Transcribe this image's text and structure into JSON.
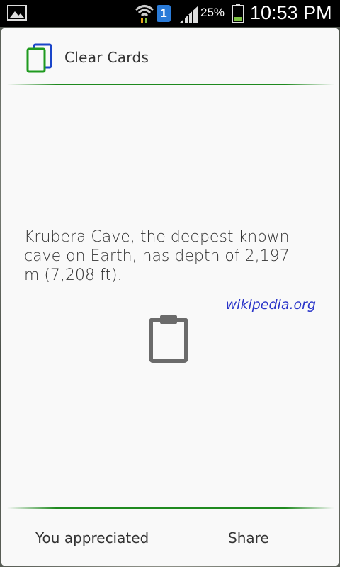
{
  "status_bar": {
    "battery_percent": "25%",
    "time": "10:53 PM",
    "sim_slot": "1",
    "icons": [
      "gallery-icon",
      "wifi-icon",
      "sim-icon",
      "signal-icon",
      "battery-icon"
    ]
  },
  "header": {
    "app_title": "Clear Cards",
    "app_icon": "cards-icon"
  },
  "card": {
    "fact_text": "Krubera Cave, the deepest known cave on Earth, has depth of 2,197 m (7,208 ft).",
    "source": "wikipedia.org",
    "center_icon": "clipboard-icon"
  },
  "footer": {
    "appreciate_label": "You appreciated",
    "share_label": "Share"
  },
  "colors": {
    "accent_green": "#1f8a1f",
    "link_blue": "#2a35c9",
    "card_bg": "#f9f9f9"
  }
}
